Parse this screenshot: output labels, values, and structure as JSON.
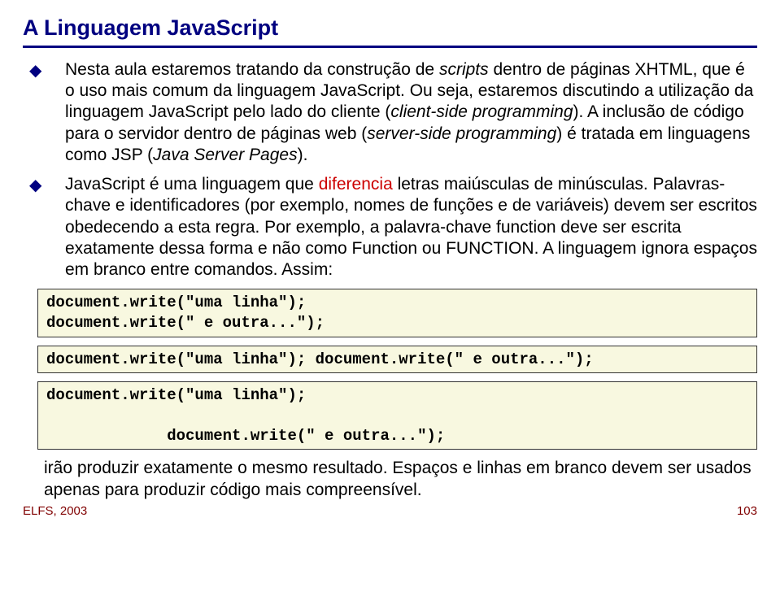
{
  "title": "A Linguagem JavaScript",
  "bullets": [
    {
      "pre": "Nesta aula estaremos tratando da construção de ",
      "em1": "scripts",
      "mid1": " dentro de páginas XHTML, que é o uso mais comum da linguagem JavaScript. Ou seja, estaremos discutindo a utilização da linguagem JavaScript pelo lado do cliente (",
      "em2": "client-side programming",
      "mid2": "). A inclusão de código para o servidor dentro de páginas web (",
      "em3": "server-side programming",
      "mid3": ") é tratada em linguagens como JSP (",
      "em4": "Java Server Pages",
      "post": ")."
    },
    {
      "pre": "JavaScript é uma linguagem que ",
      "accent": "diferencia",
      "post": " letras maiúsculas de minúsculas. Palavras-chave e identificadores (por exemplo, nomes de funções e de variáveis) devem ser escritos obedecendo a esta regra. Por exemplo, a palavra-chave function deve ser escrita exatamente dessa forma e não como Function ou FUNCTION. A linguagem ignora espaços em branco entre comandos. Assim:"
    }
  ],
  "code1": "document.write(\"uma linha\");\ndocument.write(\" e outra...\");",
  "code2": "document.write(\"uma linha\"); document.write(\" e outra...\");",
  "code3": "document.write(\"uma linha\");\n\n             document.write(\" e outra...\");",
  "closing": "irão produzir exatamente o mesmo resultado. Espaços e linhas em branco devem ser usados apenas para produzir código mais compreensível.",
  "footer_left": "ELFS, 2003",
  "footer_right": "103"
}
